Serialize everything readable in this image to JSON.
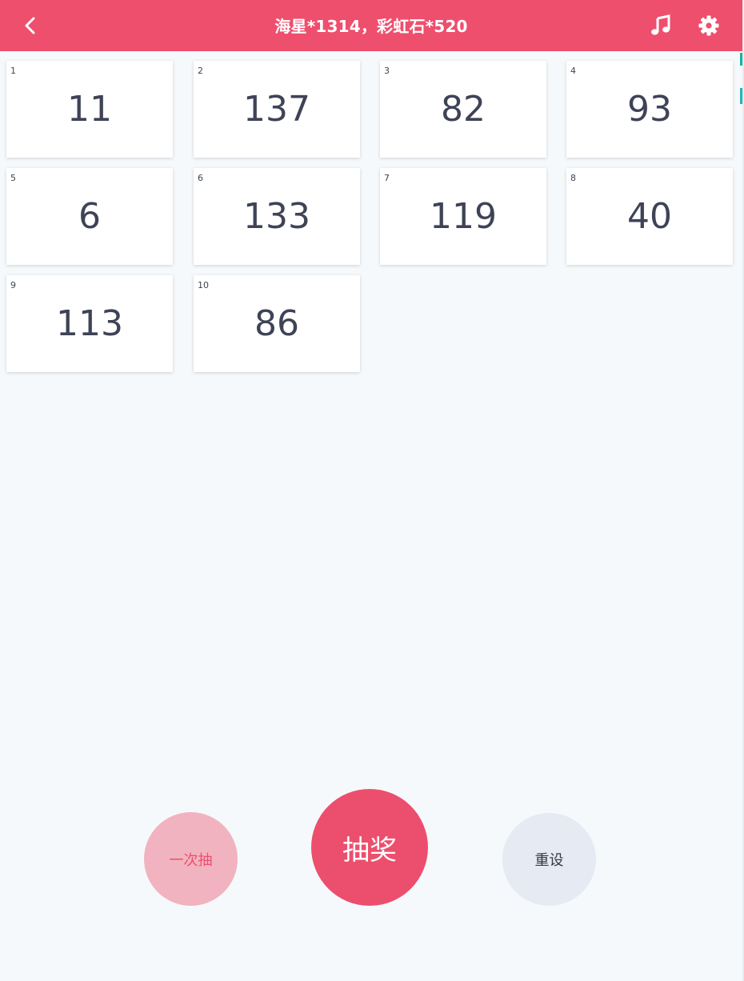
{
  "header": {
    "title": "海星*1314，彩虹石*520",
    "back_icon": "chevron-left-icon",
    "music_icon": "music-note-icon",
    "settings_icon": "gear-icon"
  },
  "cards": [
    {
      "index": "1",
      "value": "11"
    },
    {
      "index": "2",
      "value": "137"
    },
    {
      "index": "3",
      "value": "82"
    },
    {
      "index": "4",
      "value": "93"
    },
    {
      "index": "5",
      "value": "6"
    },
    {
      "index": "6",
      "value": "133"
    },
    {
      "index": "7",
      "value": "119"
    },
    {
      "index": "8",
      "value": "40"
    },
    {
      "index": "9",
      "value": "113"
    },
    {
      "index": "10",
      "value": "86"
    }
  ],
  "actions": {
    "once_label": "一次抽",
    "draw_label": "抽奖",
    "reset_label": "重设"
  },
  "colors": {
    "primary": "#ee4f6d",
    "primary_light": "#f1b3bf",
    "neutral": "#e5eaf3",
    "background": "#f6f9fc",
    "text": "#3e4356"
  }
}
